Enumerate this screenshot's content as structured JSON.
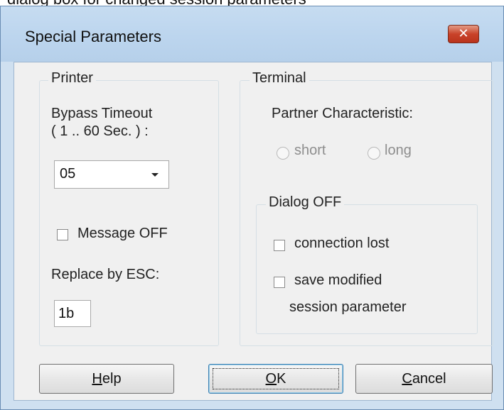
{
  "caption_fragment": "dialog box for changed session parameters",
  "window": {
    "title": "Special Parameters",
    "close_glyph": "✕"
  },
  "printer": {
    "group_label": "Printer",
    "bypass_timeout_label_line1": "Bypass Timeout",
    "bypass_timeout_label_line2": "( 1 .. 60 Sec. ) :",
    "bypass_timeout_value": "05",
    "message_off_label": "Message OFF",
    "message_off_checked": false,
    "replace_esc_label": "Replace by ESC:",
    "replace_esc_value": "1b"
  },
  "terminal": {
    "group_label": "Terminal",
    "partner_label": "Partner Characteristic:",
    "radio_short_label": "short",
    "radio_long_label": "long",
    "dialog_off": {
      "group_label": "Dialog OFF",
      "connection_lost_label": "connection lost",
      "connection_lost_checked": false,
      "save_modified_label_line1": "save modified",
      "save_modified_label_line2": "session parameter",
      "save_modified_checked": false
    }
  },
  "buttons": {
    "help": {
      "accel": "H",
      "rest": "elp"
    },
    "ok": {
      "accel": "O",
      "rest": "K"
    },
    "cancel": {
      "accel": "C",
      "rest": "ancel"
    }
  },
  "colors": {
    "frame": "#cfe0f0",
    "client": "#f0f0f0",
    "close_button": "#c9432a",
    "default_button_border": "#3c7fb1"
  }
}
